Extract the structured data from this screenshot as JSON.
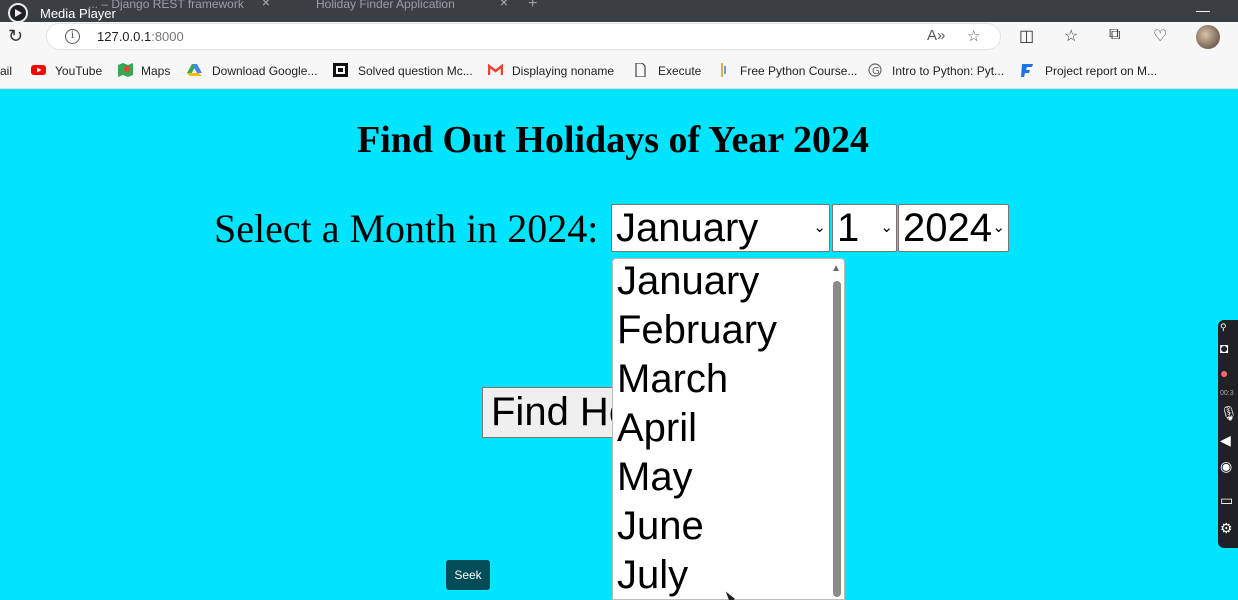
{
  "media_player": {
    "title": "Media Player"
  },
  "tabs": [
    {
      "label": "... – Django REST framework"
    },
    {
      "label": "Holiday Finder Application"
    }
  ],
  "address_bar": {
    "host": "127.0.0.1",
    "port": ":8000"
  },
  "bookmarks": [
    {
      "label": "ail"
    },
    {
      "label": "YouTube"
    },
    {
      "label": "Maps"
    },
    {
      "label": "Download Google..."
    },
    {
      "label": "Solved question Mc..."
    },
    {
      "label": "Displaying noname"
    },
    {
      "label": "Execute"
    },
    {
      "label": "Free Python Course..."
    },
    {
      "label": "Intro to Python: Pyt..."
    },
    {
      "label": "Project report on M..."
    }
  ],
  "page": {
    "title": "Find Out Holidays of Year 2024",
    "select_label": "Select a Month in 2024:",
    "month_value": "January",
    "day_value": "1",
    "year_value": "2024",
    "find_button": "Find Holidays"
  },
  "month_options": [
    "January",
    "February",
    "March",
    "April",
    "May",
    "June",
    "July"
  ],
  "seek_label": "Seek",
  "capture_toolbar": {
    "time": "00:3"
  },
  "colors": {
    "page_bg": "#00e5ff",
    "seek_bg": "#004d57"
  }
}
